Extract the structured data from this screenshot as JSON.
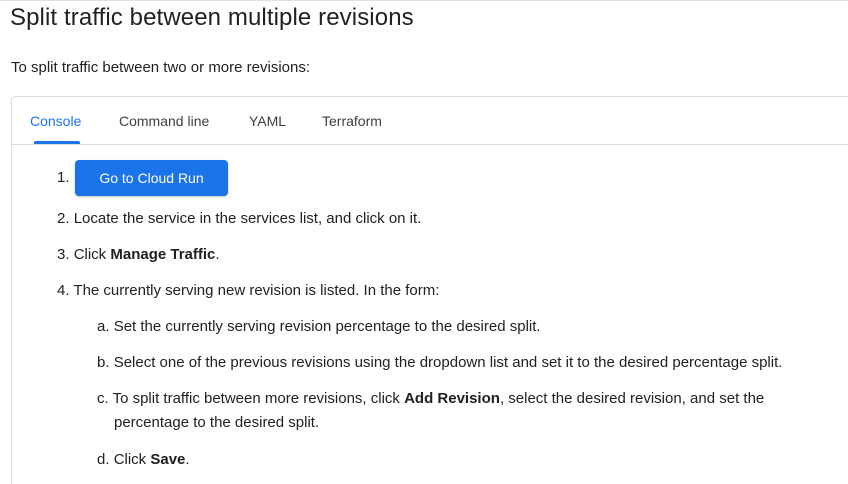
{
  "heading": "Split traffic between multiple revisions",
  "intro": "To split traffic between two or more revisions:",
  "tabs": [
    {
      "label": "Console",
      "active": true
    },
    {
      "label": "Command line",
      "active": false
    },
    {
      "label": "YAML",
      "active": false
    },
    {
      "label": "Terraform",
      "active": false
    }
  ],
  "steps": {
    "s1": {
      "number": "1.",
      "button_label": "Go to Cloud Run"
    },
    "s2": {
      "number": "2.",
      "text": "Locate the service in the services list, and click on it."
    },
    "s3": {
      "number": "3.",
      "pre": "Click ",
      "bold": "Manage Traffic",
      "post": "."
    },
    "s4": {
      "number": "4.",
      "text": "The currently serving new revision is listed. In the form:"
    }
  },
  "substeps": {
    "a": {
      "letter": "a.",
      "text": "Set the currently serving revision percentage to the desired split."
    },
    "b": {
      "letter": "b.",
      "text": "Select one of the previous revisions using the dropdown list and set it to the desired percentage split."
    },
    "c": {
      "letter": "c.",
      "pre": "To split traffic between more revisions, click ",
      "bold": "Add Revision",
      "post": ", select the desired revision, and set the",
      "line2": "percentage to the desired split."
    },
    "d": {
      "letter": "d.",
      "pre": "Click ",
      "bold": "Save",
      "post": "."
    }
  },
  "colors": {
    "accent": "#1a73e8",
    "text": "#202124",
    "border": "#dadce0"
  }
}
